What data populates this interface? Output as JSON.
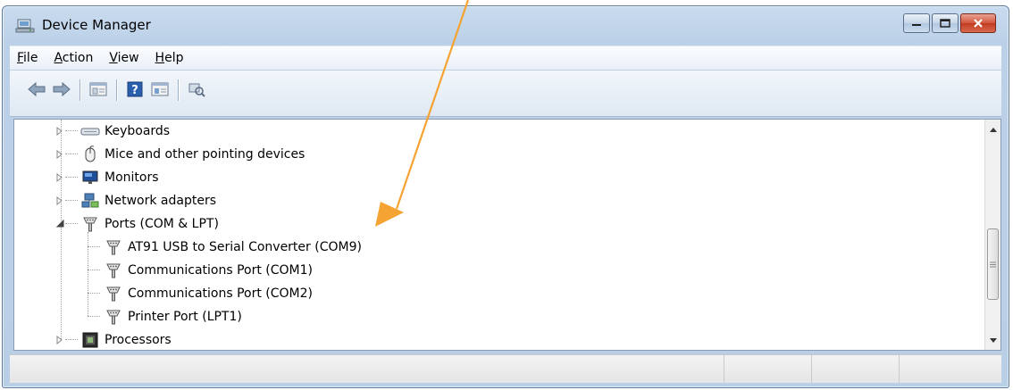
{
  "window": {
    "title": "Device Manager",
    "icon": "device-manager-icon"
  },
  "menu": [
    {
      "label": "File",
      "accel": "F",
      "rest": "ile"
    },
    {
      "label": "Action",
      "accel": "A",
      "rest": "ction"
    },
    {
      "label": "View",
      "accel": "V",
      "rest": "iew"
    },
    {
      "label": "Help",
      "accel": "H",
      "rest": "elp"
    }
  ],
  "toolbar": {
    "buttons": [
      "back-arrow-icon",
      "forward-arrow-icon",
      "properties-icon",
      "help-icon",
      "console-tree-icon",
      "scan-hardware-icon"
    ]
  },
  "tree": {
    "categories": [
      {
        "label": "Keyboards",
        "icon": "keyboard-icon",
        "expanded": false
      },
      {
        "label": "Mice and other pointing devices",
        "icon": "mouse-icon",
        "expanded": false
      },
      {
        "label": "Monitors",
        "icon": "monitor-icon",
        "expanded": false
      },
      {
        "label": "Network adapters",
        "icon": "network-adapter-icon",
        "expanded": false
      },
      {
        "label": "Ports (COM & LPT)",
        "icon": "port-icon",
        "expanded": true
      },
      {
        "label": "Processors",
        "icon": "processor-icon",
        "expanded": false
      }
    ],
    "ports": [
      {
        "label": "AT91 USB to Serial Converter (COM9)",
        "icon": "port-icon"
      },
      {
        "label": "Communications Port (COM1)",
        "icon": "port-icon"
      },
      {
        "label": "Communications Port (COM2)",
        "icon": "port-icon"
      },
      {
        "label": "Printer Port (LPT1)",
        "icon": "port-icon"
      }
    ]
  },
  "colors": {
    "annotation_arrow": "#f5a332",
    "window_frame": "#bcd1e8"
  }
}
